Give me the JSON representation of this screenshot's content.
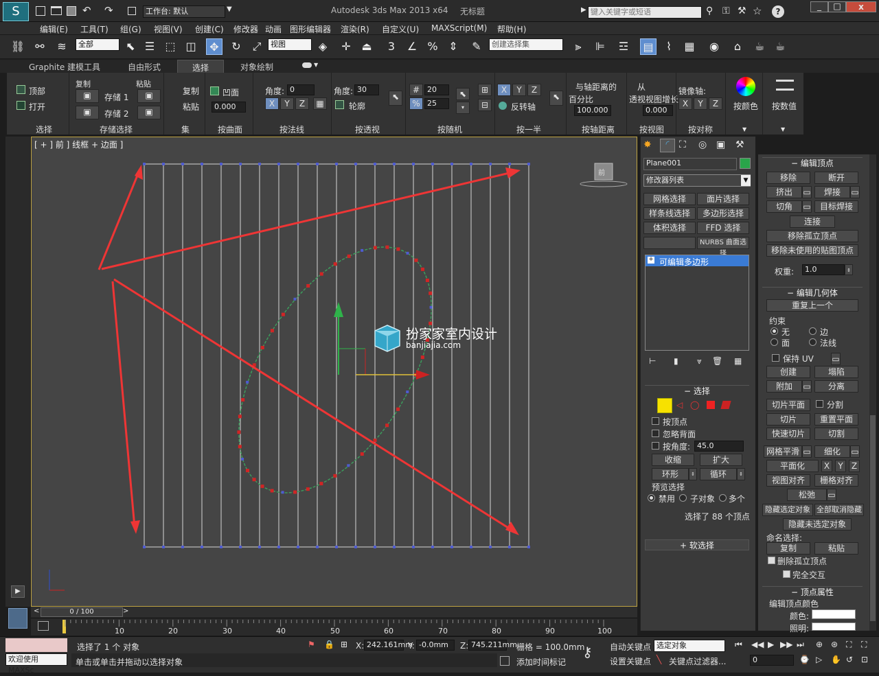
{
  "titlebar": {
    "workspace_label": "工作台: 默认",
    "app_title": "Autodesk 3ds Max  2013 x64",
    "doc_title": "无标题",
    "search_placeholder": "键入关键字或短语"
  },
  "menu": [
    "编辑(E)",
    "工具(T)",
    "组(G)",
    "视图(V)",
    "创建(C)",
    "修改器",
    "动画",
    "图形编辑器",
    "渲染(R)",
    "自定义(U)",
    "MAXScript(M)",
    "帮助(H)"
  ],
  "toolbar": {
    "filter_value": "全部",
    "refcoord_value": "视图",
    "named_sel_value": "创建选择集"
  },
  "ribbon_tabs": [
    "Graphite 建模工具",
    "自由形式",
    "选择",
    "对象绘制"
  ],
  "ribbon_active": "选择",
  "ribbon": {
    "select": {
      "top": "顶部",
      "open": "打开",
      "group": "选择"
    },
    "store": {
      "copy": "复制",
      "paste": "粘贴",
      "store1": "存储 1",
      "store2": "存储 2",
      "group": "存储选择"
    },
    "set": {
      "copy": "复制",
      "paste": "粘贴",
      "group": "集"
    },
    "bysurface": {
      "concave": "凹面",
      "value": "0.000",
      "group": "按曲面"
    },
    "bynormal": {
      "angle_label": "角度:",
      "angle": "0",
      "x": "X",
      "y": "Y",
      "z": "Z",
      "group": "按法线"
    },
    "byperspective": {
      "angle_label": "角度:",
      "angle": "30",
      "outline": "轮廓",
      "group": "按透视"
    },
    "byrandom": {
      "v1": "20",
      "v2": "25",
      "group": "按随机"
    },
    "byhalf": {
      "x": "X",
      "y": "Y",
      "z": "Z",
      "invert": "反转轴",
      "group": "按一半"
    },
    "bypivot": {
      "label1": "与轴距离的",
      "label2": "百分比",
      "value": "100.000",
      "group": "按轴距离"
    },
    "byview": {
      "label1": "从",
      "label2": "透视视图增长",
      "value": "0.000",
      "group": "按视图"
    },
    "symmetry": {
      "label": "镜像轴:",
      "x": "X",
      "y": "Y",
      "z": "Z",
      "group": "按对称"
    },
    "bycolor": "按颜色",
    "bynumeric": "按数值"
  },
  "viewport": {
    "label": "[ + ] 前 ] 线框 + 边面 ]",
    "watermark_cn": "扮家家室内设计",
    "watermark_en": "banjiajia.com",
    "cube_label": "前"
  },
  "cmdpanel": {
    "object_name": "Plane001",
    "modifier_list": "修改器列表",
    "btns": [
      "网格选择",
      "面片选择",
      "样条线选择",
      "多边形选择",
      "体积选择",
      "FFD 选择",
      "",
      "NURBS 曲面选择"
    ],
    "stack_item": "可编辑多边形"
  },
  "selection": {
    "title": "选择",
    "by_vertex": "按顶点",
    "ignore_back": "忽略背面",
    "by_angle": "按角度:",
    "angle": "45.0",
    "shrink": "收缩",
    "grow": "扩大",
    "ring": "环形",
    "loop": "循环",
    "preview": "预览选择",
    "disable": "禁用",
    "subobj": "子对象",
    "multi": "多个",
    "status": "选择了 88 个顶点",
    "soft": "软选择"
  },
  "editvert": {
    "title": "编辑顶点",
    "remove": "移除",
    "break": "断开",
    "extrude": "挤出",
    "weld": "焊接",
    "chamfer": "切角",
    "targetweld": "目标焊接",
    "connect": "连接",
    "remove_iso": "移除孤立顶点",
    "remove_unused": "移除未使用的贴图顶点",
    "weight_label": "权重:",
    "weight": "1.0"
  },
  "editgeom": {
    "title": "编辑几何体",
    "repeat": "重复上一个",
    "constraint": "约束",
    "none": "无",
    "edge": "边",
    "face": "面",
    "normal": "法线",
    "keep_uv": "保持 UV",
    "create": "创建",
    "collapse": "塌陷",
    "attach": "附加",
    "detach": "分离",
    "slice_plane": "切片平面",
    "split": "分割",
    "slice": "切片",
    "reset_plane": "重置平面",
    "quickslice": "快速切片",
    "cut": "切割",
    "meshsmooth": "网格平滑",
    "tessellate": "细化",
    "planarize": "平面化",
    "x": "X",
    "y": "Y",
    "z": "Z",
    "view_align": "视图对齐",
    "grid_align": "栅格对齐",
    "relax": "松弛",
    "hide_sel": "隐藏选定对象",
    "unhide_all": "全部取消隐藏",
    "hide_unsel": "隐藏未选定对象",
    "named_sel": "命名选择:",
    "copy": "复制",
    "paste": "粘贴",
    "delete_iso": "删除孤立顶点",
    "full_interact": "完全交互"
  },
  "vertprops": {
    "title": "顶点属性",
    "edit_color": "编辑顶点颜色",
    "color": "颜色:",
    "illum": "照明:"
  },
  "timeline": {
    "frame": "0 / 100",
    "ticks": [
      "10",
      "20",
      "30",
      "40",
      "50",
      "60",
      "70",
      "80",
      "90",
      "100"
    ]
  },
  "status": {
    "welcome": "欢迎使用 MAXSc",
    "selected": "选择了 1 个 对象",
    "hint": "单击或单击并拖动以选择对象",
    "x_label": "X:",
    "x": "242.161mm",
    "y_label": "Y:",
    "y": "-0.0mm",
    "z_label": "Z:",
    "z": "745.211mm",
    "grid": "栅格 = 100.0mm",
    "autokey": "自动关键点",
    "setkey": "设置关键点",
    "sel_obj": "选定对象",
    "key_filter": "关键点过滤器...",
    "add_time_tag": "添加时间标记",
    "frame_field": "0"
  }
}
